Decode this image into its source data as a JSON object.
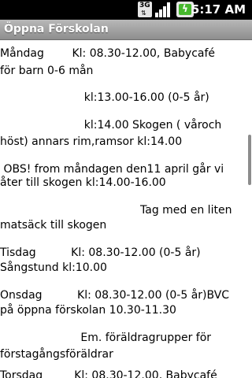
{
  "status_bar": {
    "network_label": "3G",
    "time": "5:17 AM"
  },
  "title_bar": {
    "title": "Öppna Förskolan"
  },
  "content": {
    "lines": [
      "Måndag        Kl: 08.30-12.00, Babycafé",
      "för barn 0-6 mån",
      "",
      "                        kl:13.00-16.00 (0-5 år)",
      "",
      "                        kl:14.00 Skogen ( våroch",
      "höst) annars rim,ramsor kl:14.00",
      "",
      " OBS! from måndagen den11 april går vi",
      "åter till skogen kl:14.00-16.00",
      "",
      "                                        Tag med en liten",
      "matsäck till skogen",
      "",
      "Tisdag          Kl: 08.30-12.00 (0-5 år)",
      "Sångstund kl:10.00",
      "",
      "Onsdag          Kl: 08.30-12.00 (0-5 år)BVC",
      "på öppna förskolan 10.30-11.30",
      "",
      "                       Em. föräldragrupper för",
      "förstagångsföräldrar",
      "",
      "Torsdag         Kl: 08.30-12.00, Babycafé"
    ]
  }
}
